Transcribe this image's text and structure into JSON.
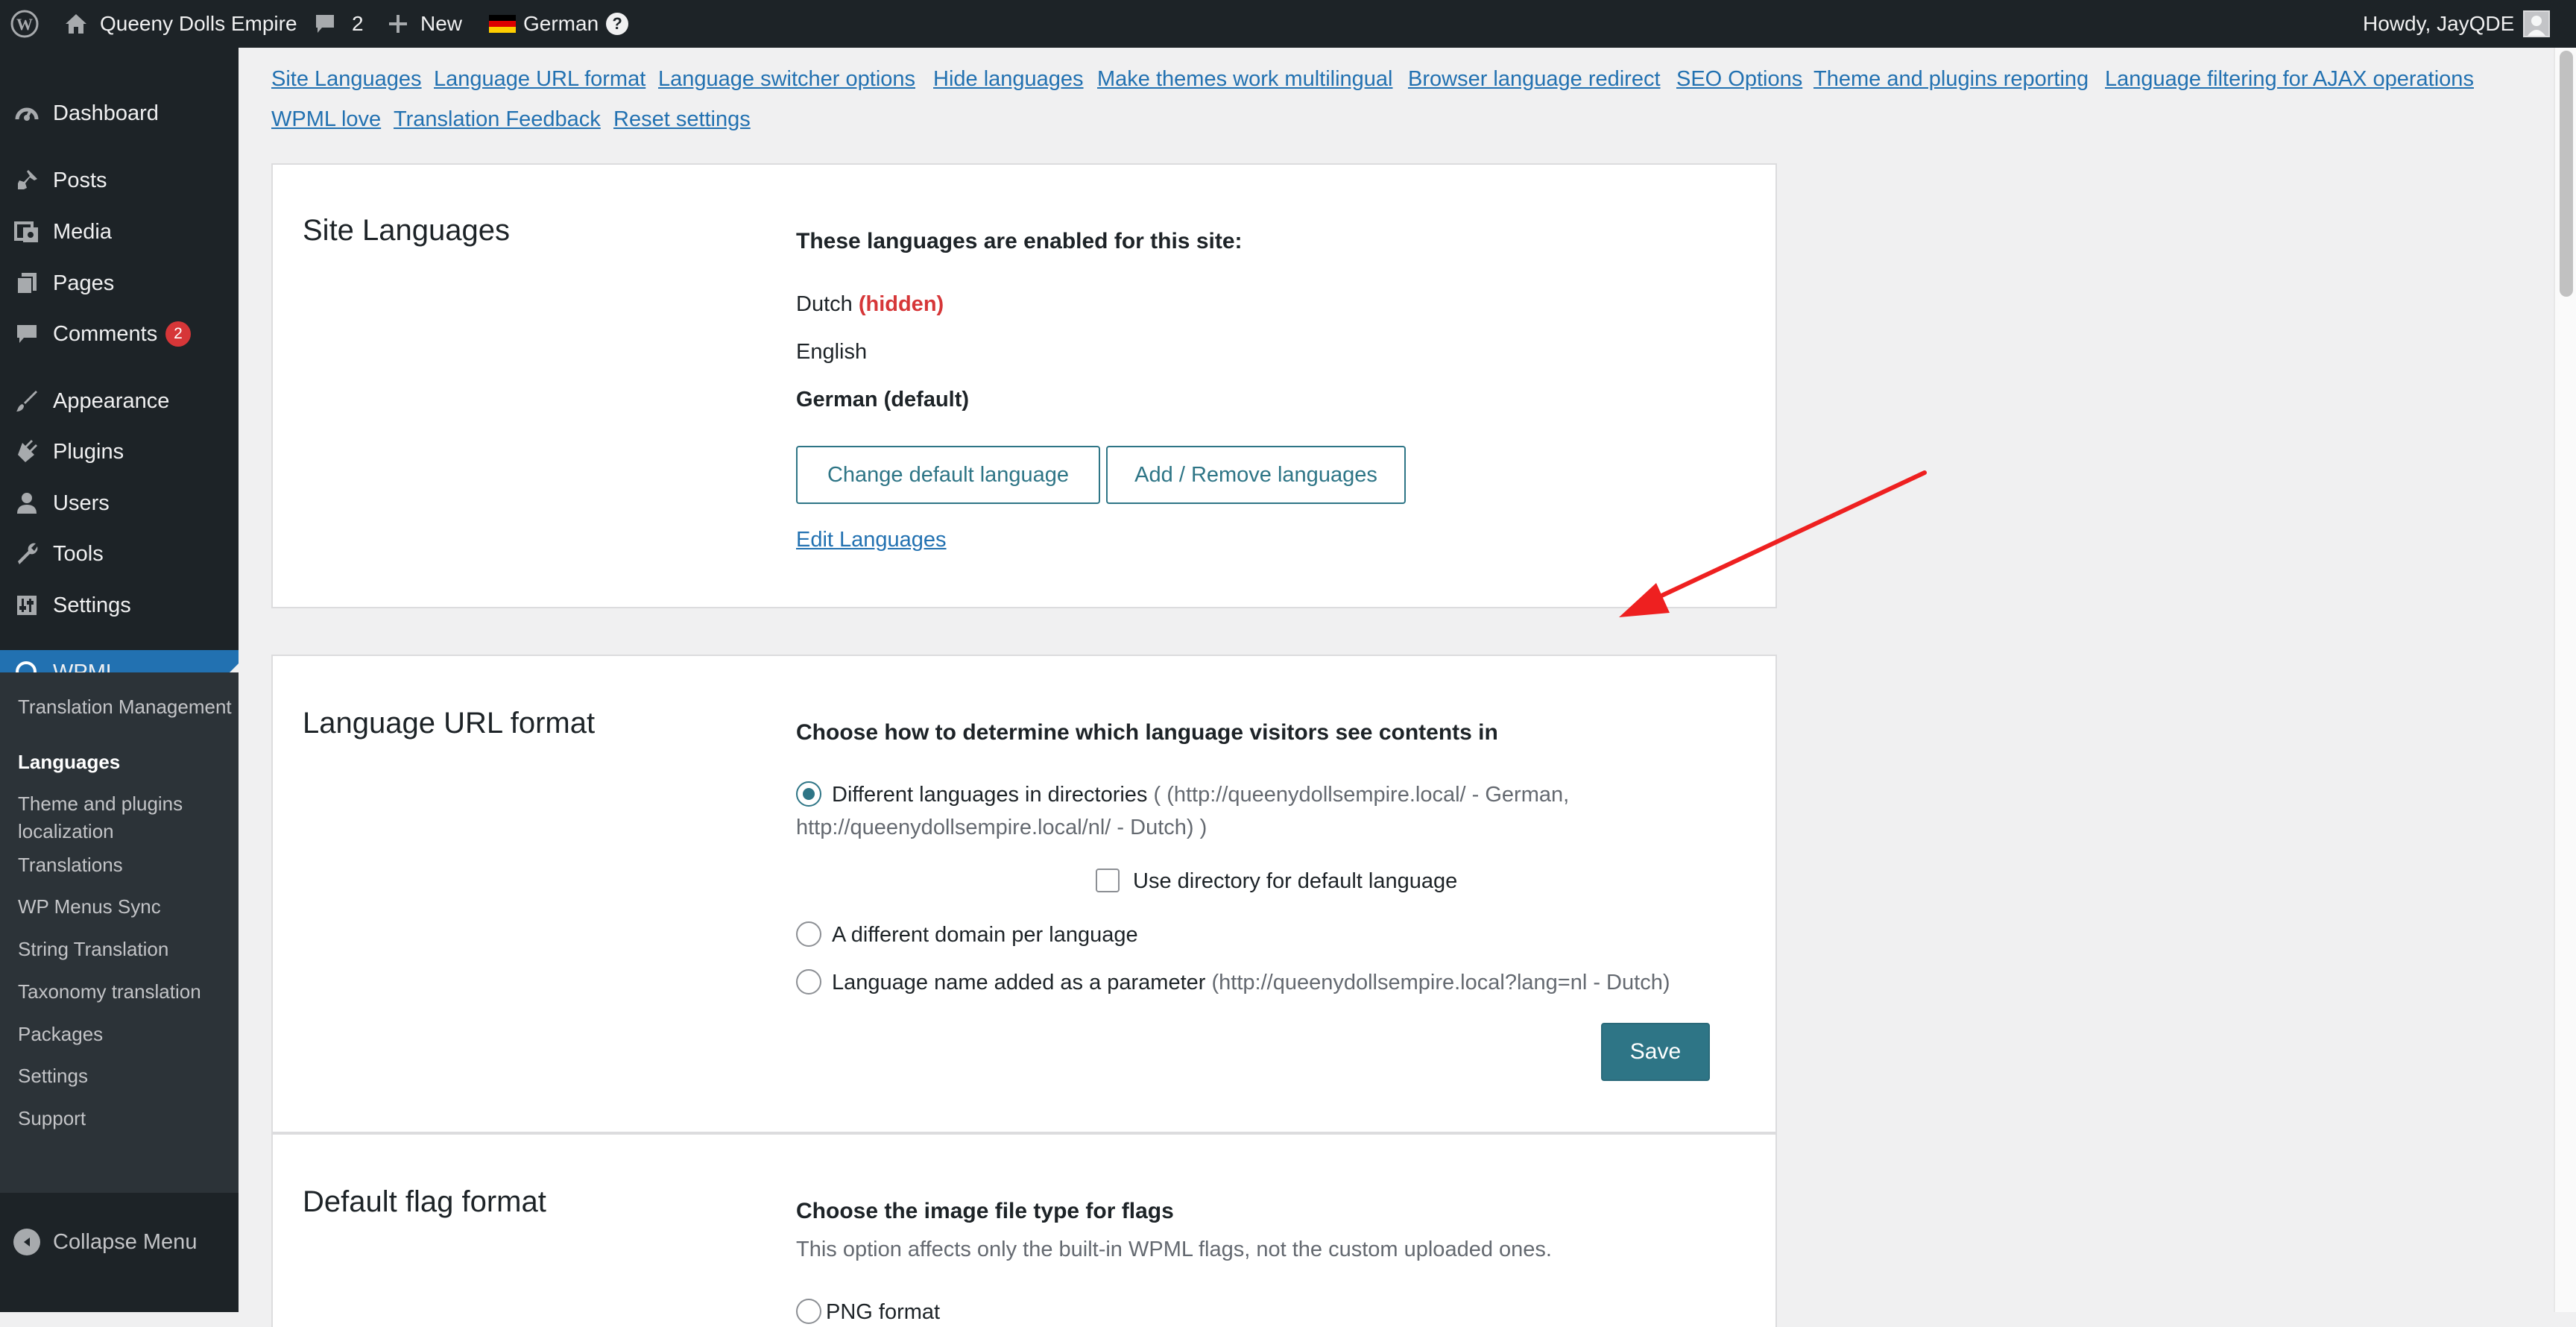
{
  "admin_bar": {
    "site_name": "Queeny Dolls Empire",
    "comments_count": "2",
    "new_label": "New",
    "language_label": "German",
    "help_symbol": "?",
    "howdy_text": "Howdy, JayQDE"
  },
  "sidebar": {
    "items": [
      {
        "label": "Dashboard"
      },
      {
        "label": "Posts"
      },
      {
        "label": "Media"
      },
      {
        "label": "Pages"
      },
      {
        "label": "Comments",
        "badge": "2"
      },
      {
        "label": "Appearance"
      },
      {
        "label": "Plugins"
      },
      {
        "label": "Users"
      },
      {
        "label": "Tools"
      },
      {
        "label": "Settings"
      },
      {
        "label": "WPML"
      }
    ],
    "submenu": [
      {
        "label": "Translation Management"
      },
      {
        "label": "Languages"
      },
      {
        "label": "Theme and plugins localization"
      },
      {
        "label": "Translations"
      },
      {
        "label": "WP Menus Sync"
      },
      {
        "label": "String Translation"
      },
      {
        "label": "Taxonomy translation"
      },
      {
        "label": "Packages"
      },
      {
        "label": "Settings"
      },
      {
        "label": "Support"
      }
    ],
    "collapse_label": "Collapse Menu"
  },
  "section_links": [
    "Site Languages",
    "Language URL format",
    "Language switcher options",
    "Hide languages",
    "Make themes work multilingual",
    "Browser language redirect",
    "SEO Options",
    "Theme and plugins reporting",
    "Language filtering for AJAX operations",
    "WPML love",
    "Translation Feedback",
    "Reset settings"
  ],
  "site_languages": {
    "title": "Site Languages",
    "heading": "These languages are enabled for this site:",
    "dutch": "Dutch",
    "hidden_tag": "(hidden)",
    "english": "English",
    "german_default": "German (default)",
    "change_default_button": "Change default language",
    "add_remove_button": "Add / Remove languages",
    "edit_link": "Edit Languages"
  },
  "url_format": {
    "title": "Language URL format",
    "heading": "Choose how to determine which language visitors see contents in",
    "opt_directories": "Different languages in directories",
    "opt_directories_hint_1": "( (http://queenydollsempire.local/ - German,",
    "opt_directories_hint_2": "http://queenydollsempire.local/nl/ - Dutch) )",
    "use_directory_label": "Use directory for default language",
    "opt_domain": "A different domain per language",
    "opt_parameter": "Language name added as a parameter",
    "opt_parameter_hint": "(http://queenydollsempire.local?lang=nl - Dutch)",
    "save_button": "Save"
  },
  "flag_format": {
    "title": "Default flag format",
    "heading": "Choose the image file type for flags",
    "description": "This option affects only the built-in WPML flags, not the custom uploaded ones.",
    "png_option": "PNG format"
  },
  "colors": {
    "admin_bar_bg": "#1d2327",
    "accent": "#2271b1",
    "button_teal": "#2e7586",
    "hidden_red": "#d63638",
    "annotation_arrow": "#ee2020"
  }
}
